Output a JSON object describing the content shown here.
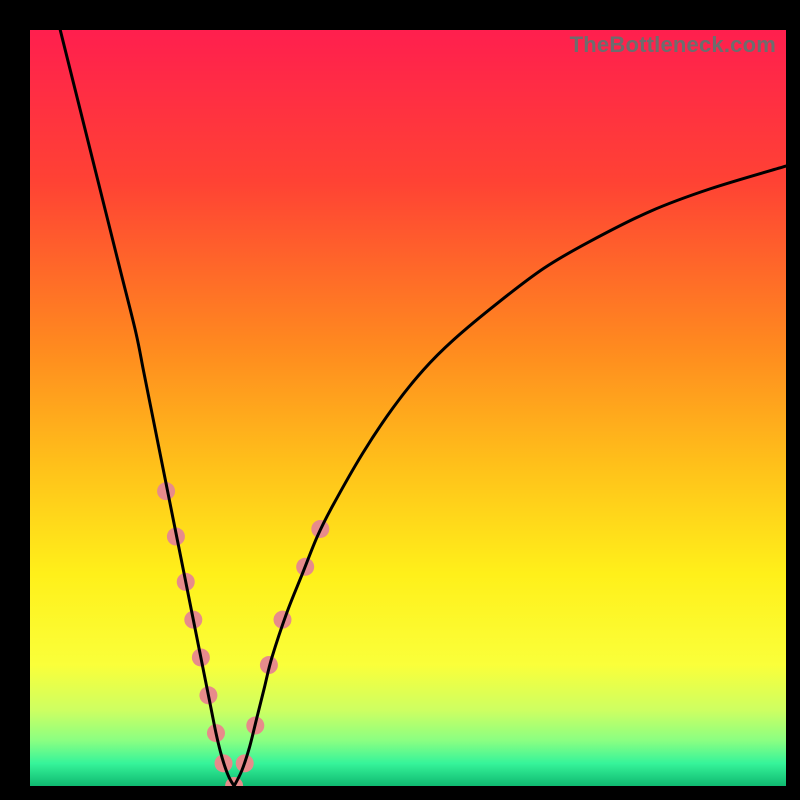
{
  "watermark": "TheBottleneck.com",
  "chart_data": {
    "type": "line",
    "title": "",
    "xlabel": "",
    "ylabel": "",
    "xlim": [
      0,
      100
    ],
    "ylim": [
      0,
      100
    ],
    "grid": false,
    "legend": false,
    "background_gradient_stops": [
      {
        "t": 0.0,
        "color": "#ff1f4e"
      },
      {
        "t": 0.2,
        "color": "#ff4234"
      },
      {
        "t": 0.42,
        "color": "#ff8a1f"
      },
      {
        "t": 0.58,
        "color": "#ffc21a"
      },
      {
        "t": 0.72,
        "color": "#fff01a"
      },
      {
        "t": 0.84,
        "color": "#faff3a"
      },
      {
        "t": 0.9,
        "color": "#cdff62"
      },
      {
        "t": 0.94,
        "color": "#8aff82"
      },
      {
        "t": 0.97,
        "color": "#36f49a"
      },
      {
        "t": 1.0,
        "color": "#0fb970"
      }
    ],
    "series": [
      {
        "name": "left-curve",
        "color": "#000000",
        "x": [
          4,
          6,
          8,
          10,
          12,
          14,
          15,
          16,
          17,
          18,
          19,
          20,
          20.8,
          21.6,
          22.4,
          23.2,
          24.0,
          24.6,
          25.2,
          25.8,
          26.4,
          27
        ],
        "y": [
          100,
          92,
          84,
          76,
          68,
          60,
          55,
          50,
          45,
          40,
          35,
          30,
          26,
          22,
          18,
          14,
          10,
          7,
          4.5,
          2.5,
          1,
          0
        ]
      },
      {
        "name": "right-curve",
        "color": "#000000",
        "x": [
          27,
          28,
          29,
          30,
          31,
          32,
          34,
          36,
          38,
          40,
          44,
          48,
          52,
          56,
          62,
          68,
          74,
          82,
          90,
          100
        ],
        "y": [
          0,
          2,
          5,
          9,
          13,
          17,
          23,
          28,
          33,
          37,
          44,
          50,
          55,
          59,
          64,
          68.5,
          72,
          76,
          79,
          82
        ]
      }
    ],
    "markers": {
      "name": "highlight-points",
      "color": "#e78b8b",
      "radius_px": 9,
      "points": [
        {
          "x": 18.0,
          "y": 39
        },
        {
          "x": 19.3,
          "y": 33
        },
        {
          "x": 20.6,
          "y": 27
        },
        {
          "x": 21.6,
          "y": 22
        },
        {
          "x": 22.6,
          "y": 17
        },
        {
          "x": 23.6,
          "y": 12
        },
        {
          "x": 24.6,
          "y": 7
        },
        {
          "x": 25.6,
          "y": 3
        },
        {
          "x": 27.0,
          "y": 0
        },
        {
          "x": 28.4,
          "y": 3
        },
        {
          "x": 29.8,
          "y": 8
        },
        {
          "x": 31.6,
          "y": 16
        },
        {
          "x": 33.4,
          "y": 22
        },
        {
          "x": 36.4,
          "y": 29
        },
        {
          "x": 38.4,
          "y": 34
        }
      ]
    }
  }
}
